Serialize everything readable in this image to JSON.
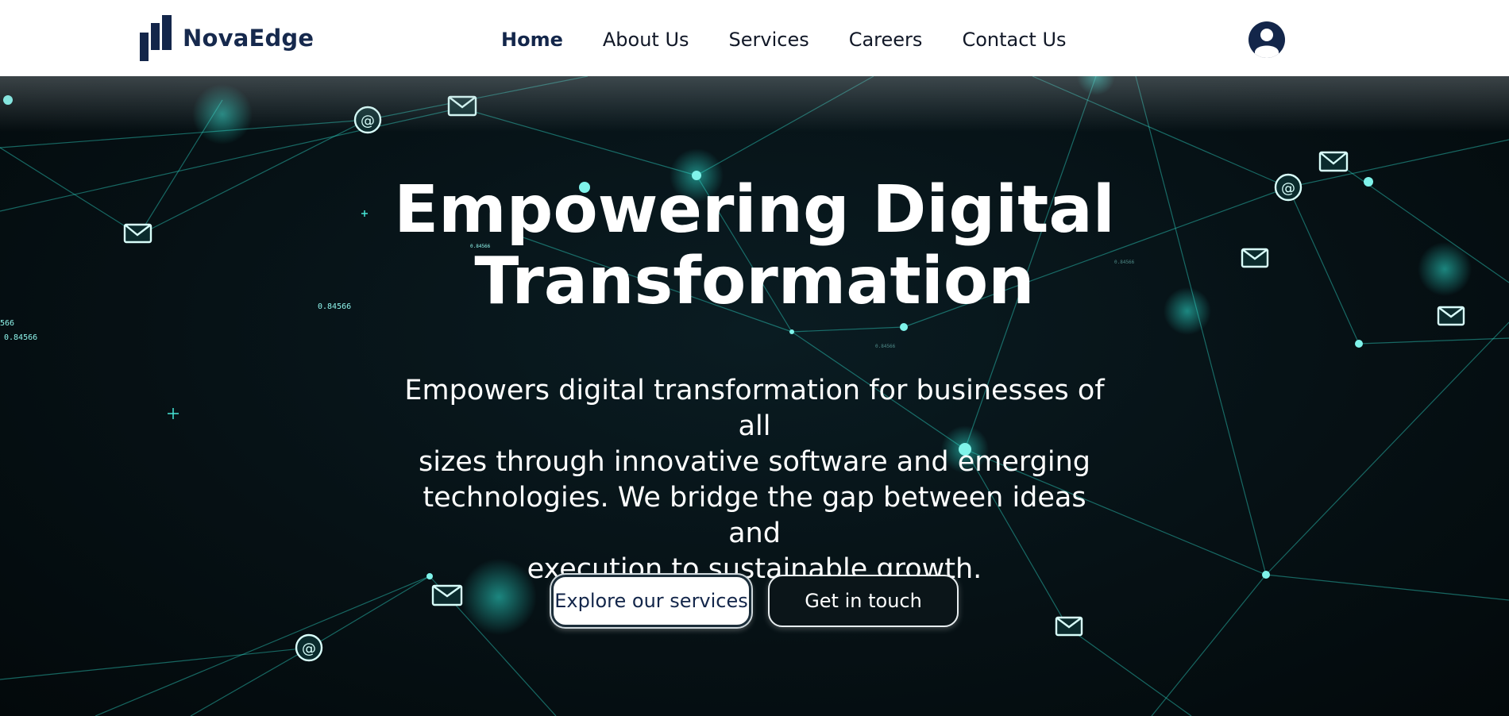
{
  "brand": {
    "name": "NovaEdge",
    "color": "#13264a"
  },
  "nav": {
    "items": [
      {
        "label": "Home",
        "active": true
      },
      {
        "label": "About Us",
        "active": false
      },
      {
        "label": "Services",
        "active": false
      },
      {
        "label": "Careers",
        "active": false
      },
      {
        "label": "Contact Us",
        "active": false
      }
    ]
  },
  "header": {
    "account_icon": "user-circle-icon"
  },
  "hero": {
    "title_line1": "Empowering Digital",
    "title_line2": "Transformation",
    "subtitle_line1": "Empowers digital transformation for businesses of all",
    "subtitle_line2": "sizes through innovative software and emerging",
    "subtitle_line3": "technologies. We bridge the gap between ideas and",
    "subtitle_line4": "execution to sustainable growth.",
    "primary_button": "Explore our services",
    "secondary_button": "Get in touch",
    "background": {
      "theme": "network-mesh",
      "accent_color": "#2ee6d6",
      "floating_labels": [
        "0.84566",
        "0.84566",
        "0.84566",
        "0.84566",
        "0.84566",
        "566"
      ],
      "icons": [
        "email-icon",
        "at-sign-icon",
        "plus-icon"
      ]
    }
  }
}
